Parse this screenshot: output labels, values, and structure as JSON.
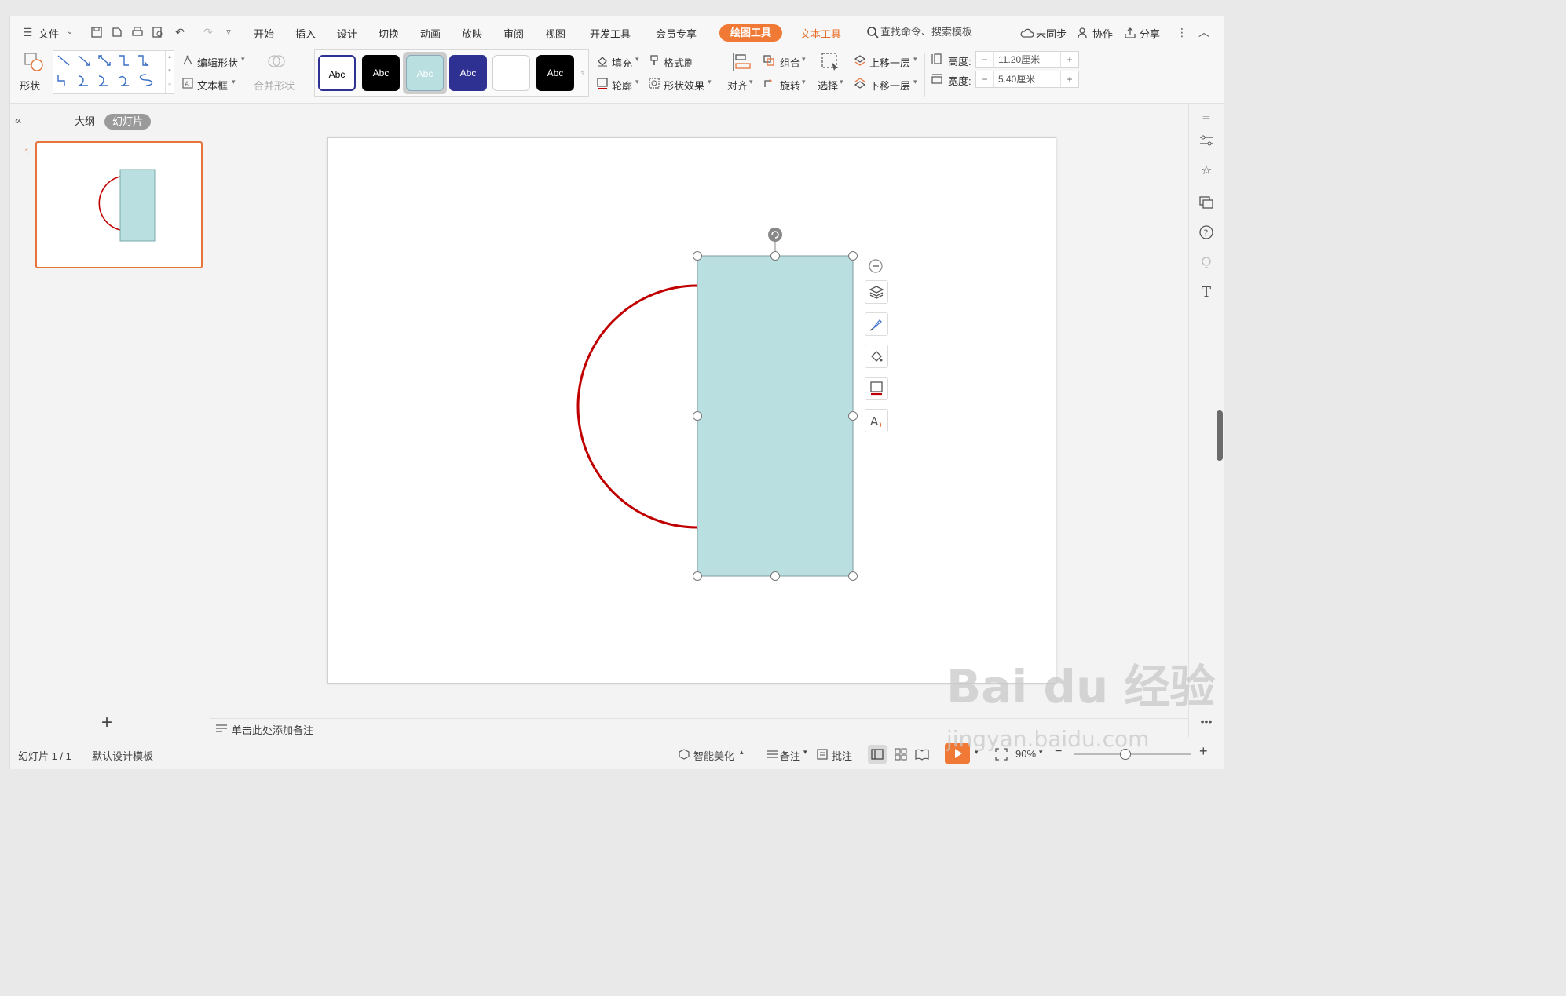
{
  "menubar": {
    "file": "文件",
    "tabs": [
      "开始",
      "插入",
      "设计",
      "切换",
      "动画",
      "放映",
      "审阅",
      "视图",
      "开发工具",
      "会员专享"
    ],
    "active_tab": "绘图工具",
    "text_tool_tab": "文本工具",
    "search_placeholder": "查找命令、搜索模板",
    "sync": "未同步",
    "collab": "协作",
    "share": "分享"
  },
  "ribbon": {
    "shape": "形状",
    "edit_shape": "编辑形状",
    "textbox": "文本框",
    "merge_shape": "合并形状",
    "style_label": "Abc",
    "fill": "填充",
    "format_painter": "格式刷",
    "outline": "轮廓",
    "shape_effect": "形状效果",
    "align": "对齐",
    "group": "组合",
    "rotate": "旋转",
    "select": "选择",
    "bring_forward": "上移一层",
    "send_backward": "下移一层",
    "height_label": "高度:",
    "height_value": "11.20厘米",
    "width_label": "宽度:",
    "width_value": "5.40厘米",
    "minus": "−",
    "plus": "+"
  },
  "colors": {
    "accent": "#f07a35",
    "shape_fill": "#b9dfe1",
    "arc_stroke": "#c00000",
    "dark_blue": "#2e3192",
    "thumb_border": "#e8743b"
  },
  "left_panel": {
    "outline_tab": "大纲",
    "slides_tab": "幻灯片",
    "slide_number": "1",
    "add": "+"
  },
  "notes": {
    "placeholder": "单击此处添加备注"
  },
  "status": {
    "slide_info": "幻灯片 1 / 1",
    "template": "默认设计模板",
    "smart": "智能美化",
    "notes": "备注",
    "comment": "批注",
    "zoom": "90%"
  },
  "watermark": {
    "brand": "Bai du 经验",
    "url": "jingyan.baidu.com"
  }
}
